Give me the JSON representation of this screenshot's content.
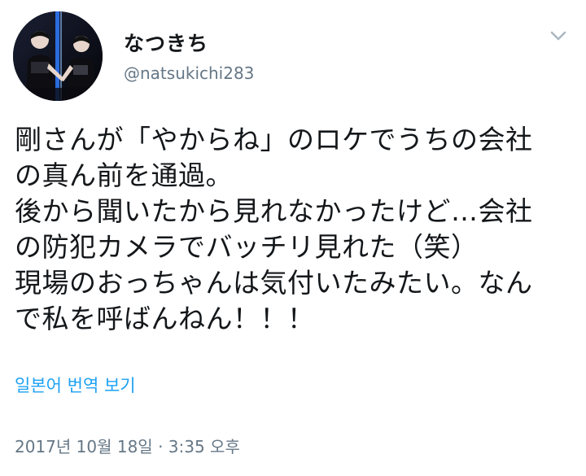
{
  "tweet": {
    "display_name": "なつきち",
    "handle": "@natsukichi283",
    "text": "剛さんが「やからね」のロケでうちの会社\nの真ん前を通過。\n後から聞いたから見れなかったけど…会社\nの防犯カメラでバッチリ見れた（笑）\n現場のおっちゃんは気付いたみたい。なん\nで私を呼ばんねん！！！",
    "translate_label": "일본어 번역 보기",
    "timestamp": "2017년 10월 18일 · 3:35 오후"
  },
  "icons": {
    "menu": "chevron-down-icon",
    "avatar": "profile-photo"
  },
  "colors": {
    "link": "#1da1f2",
    "secondary_text": "#657786",
    "primary_text": "#14171a",
    "chevron": "#aab8c2"
  }
}
